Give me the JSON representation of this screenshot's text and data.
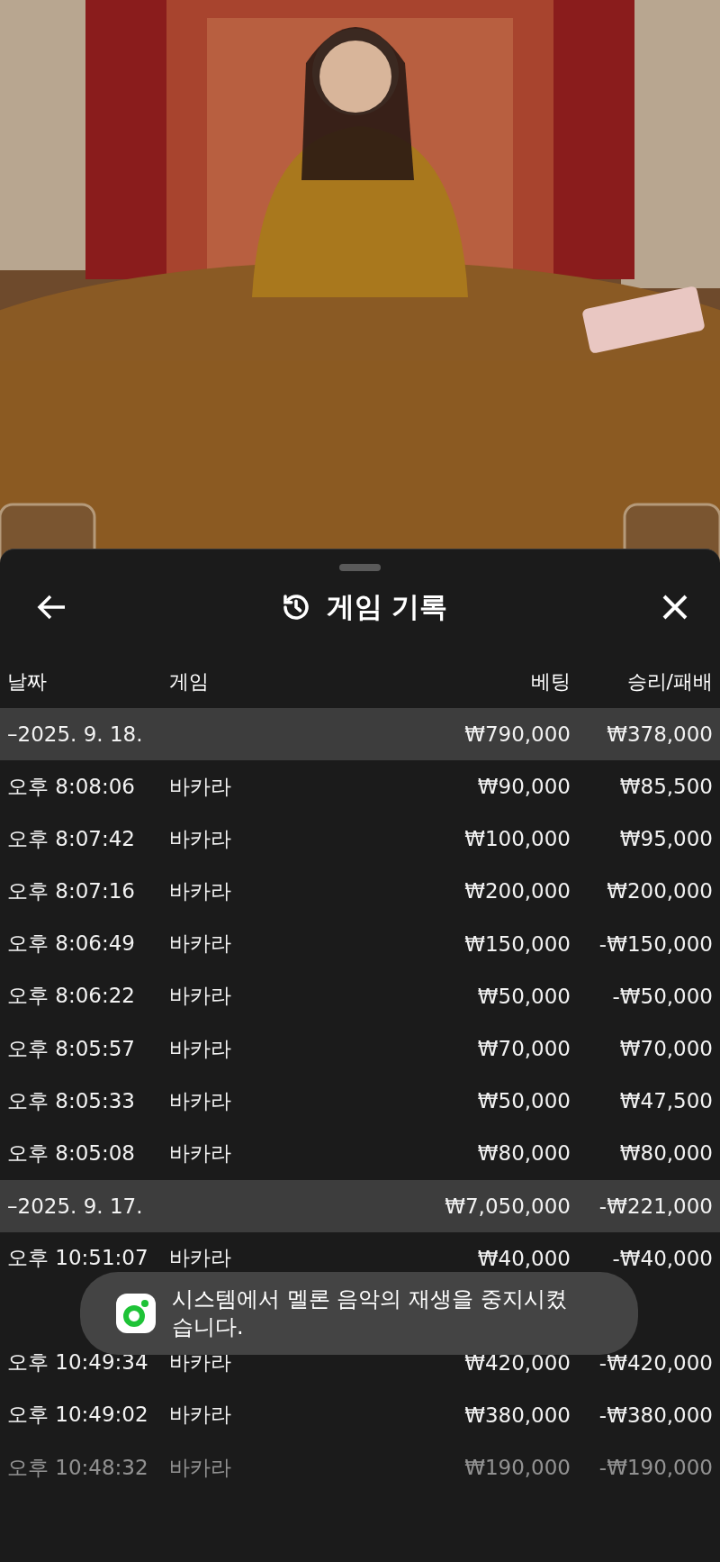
{
  "sheet": {
    "title": "게임 기록",
    "columns": [
      "날짜",
      "게임",
      "베팅",
      "승리/패배"
    ],
    "groups": [
      {
        "date": "–2025. 9. 18.",
        "bet": "₩790,000",
        "result": "₩378,000",
        "rows": [
          {
            "time": "오후 8:08:06",
            "game": "바카라",
            "bet": "₩90,000",
            "result": "₩85,500",
            "dimmed": false
          },
          {
            "time": "오후 8:07:42",
            "game": "바카라",
            "bet": "₩100,000",
            "result": "₩95,000",
            "dimmed": false
          },
          {
            "time": "오후 8:07:16",
            "game": "바카라",
            "bet": "₩200,000",
            "result": "₩200,000",
            "dimmed": false
          },
          {
            "time": "오후 8:06:49",
            "game": "바카라",
            "bet": "₩150,000",
            "result": "-₩150,000",
            "dimmed": false
          },
          {
            "time": "오후 8:06:22",
            "game": "바카라",
            "bet": "₩50,000",
            "result": "-₩50,000",
            "dimmed": false
          },
          {
            "time": "오후 8:05:57",
            "game": "바카라",
            "bet": "₩70,000",
            "result": "₩70,000",
            "dimmed": false
          },
          {
            "time": "오후 8:05:33",
            "game": "바카라",
            "bet": "₩50,000",
            "result": "₩47,500",
            "dimmed": false
          },
          {
            "time": "오후 8:05:08",
            "game": "바카라",
            "bet": "₩80,000",
            "result": "₩80,000",
            "dimmed": false
          }
        ]
      },
      {
        "date": "–2025. 9. 17.",
        "bet": "₩7,050,000",
        "result": "-₩221,000",
        "rows": [
          {
            "time": "오후 10:51:07",
            "game": "바카라",
            "bet": "₩40,000",
            "result": "-₩40,000",
            "dimmed": false
          },
          {
            "time": "오후 10:49:34",
            "game": "바카라",
            "bet": "₩420,000",
            "result": "-₩420,000",
            "dimmed": false
          },
          {
            "time": "오후 10:49:02",
            "game": "바카라",
            "bet": "₩380,000",
            "result": "-₩380,000",
            "dimmed": false
          },
          {
            "time": "오후 10:48:32",
            "game": "바카라",
            "bet": "₩190,000",
            "result": "-₩190,000",
            "dimmed": true
          }
        ]
      }
    ]
  },
  "toast": {
    "message": "시스템에서 멜론 음악의 재생을 중지시켰습니다."
  }
}
